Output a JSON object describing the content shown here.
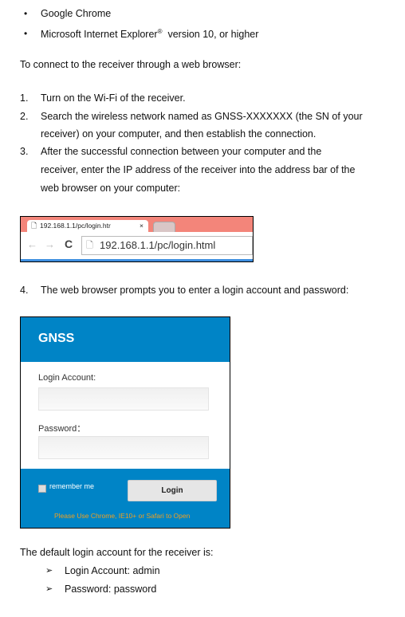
{
  "bullets": [
    "Google Chrome",
    "Microsoft Internet Explorer",
    "version 10, or higher"
  ],
  "registered": "®",
  "intro": "To connect to the receiver through a web browser:",
  "steps": [
    {
      "num": "1.",
      "lines": [
        "Turn on the Wi-Fi of the receiver."
      ]
    },
    {
      "num": "2.",
      "lines": [
        "Search the wireless network named as GNSS-XXXXXXX (the SN of your",
        "receiver) on your computer, and then establish the connection."
      ]
    },
    {
      "num": "3.",
      "lines": [
        "After the successful connection between your computer and the",
        "receiver, enter the IP address of the receiver into the address bar of the",
        "web browser on your computer:"
      ]
    },
    {
      "num": "4.",
      "lines": [
        "The web browser prompts you to enter a login account and password:"
      ]
    }
  ],
  "browser": {
    "tab_title": "192.168.1.1/pc/login.htr",
    "tab_close": "×",
    "back": "←",
    "forward": "→",
    "reload": "C",
    "url": "192.168.1.1/pc/login.html"
  },
  "login": {
    "brand": "GNSS",
    "account_label": "Login Account:",
    "password_label": "Password：",
    "remember": "remember me",
    "button": "Login",
    "notice": "Please Use Chrome, IE10+ or Safari to Open",
    "accent": "#0084c6",
    "notice_color": "#f0a020"
  },
  "default_intro": "The default login account for the receiver is:",
  "defaults": [
    "Login Account: admin",
    "Password: password"
  ]
}
